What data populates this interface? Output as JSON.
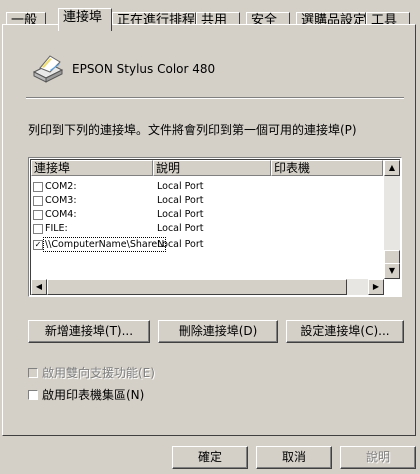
{
  "tabs": [
    {
      "label": "一般"
    },
    {
      "label": "連接埠"
    },
    {
      "label": "正在進行排程"
    },
    {
      "label": "共用"
    },
    {
      "label": "安全"
    },
    {
      "label": "選購品設定"
    },
    {
      "label": "工具"
    }
  ],
  "printer": {
    "name": "EPSON Stylus Color 480",
    "icon": "printer-icon"
  },
  "instruction": "列印到下列的連接埠。文件將會列印到第一個可用的連接埠(P)",
  "port_list": {
    "columns": [
      "連接埠",
      "說明",
      "印表機"
    ],
    "rows": [
      {
        "port": "COM2:",
        "desc": "Local Port",
        "checked": false
      },
      {
        "port": "COM3:",
        "desc": "Local Port",
        "checked": false
      },
      {
        "port": "COM4:",
        "desc": "Local Port",
        "checked": false
      },
      {
        "port": "FILE:",
        "desc": "Local Port",
        "checked": false
      },
      {
        "port": "\\\\ComputerName\\ShareN",
        "desc": "Local Port",
        "checked": true
      }
    ]
  },
  "buttons": {
    "add_port": "新增連接埠(T)...",
    "delete_port": "刪除連接埠(D)",
    "config_port": "設定連接埠(C)..."
  },
  "options": {
    "bidirectional": "啟用雙向支援功能(E)",
    "pooling": "啟用印表機集區(N)"
  },
  "footer": {
    "ok": "確定",
    "cancel": "取消",
    "help": "說明"
  }
}
